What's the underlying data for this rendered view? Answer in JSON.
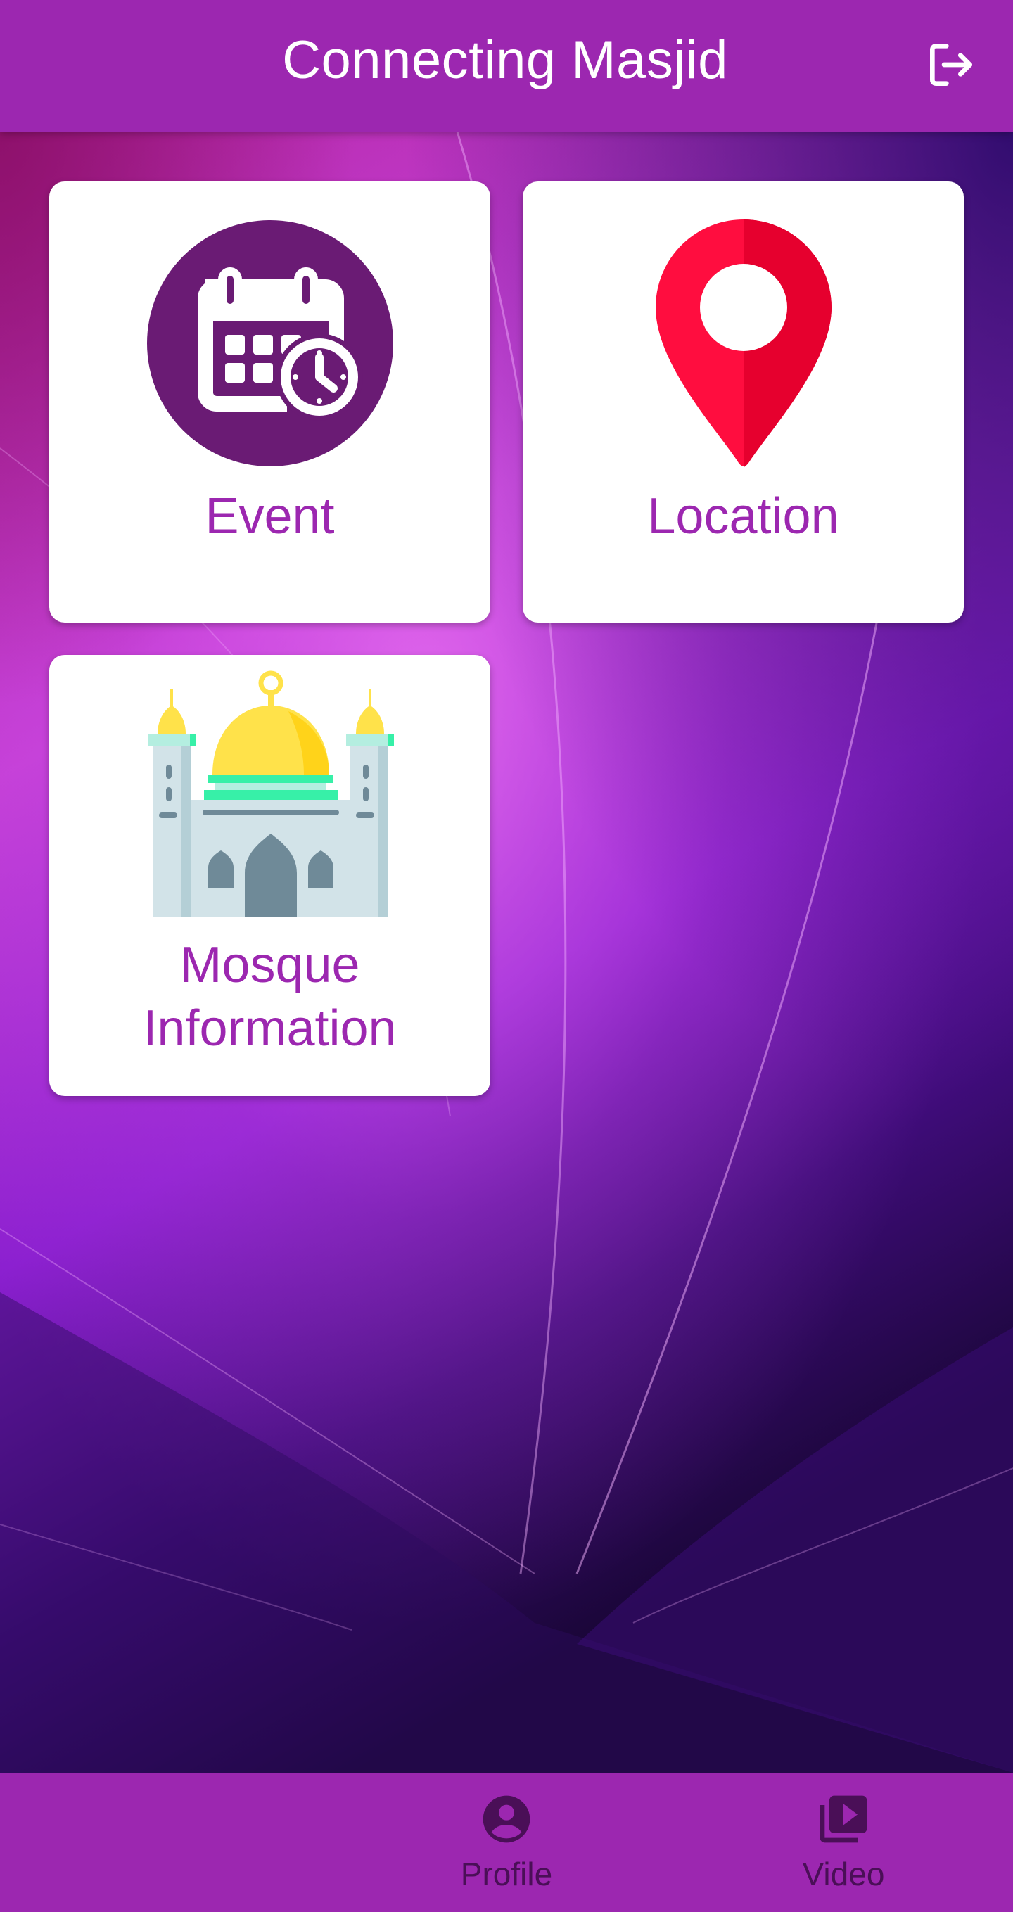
{
  "app_bar": {
    "title": "Connecting Masjid",
    "logout_icon": "logout-icon"
  },
  "menu": {
    "cards": [
      {
        "label": "Event",
        "icon": "calendar-clock-icon"
      },
      {
        "label": "Location",
        "icon": "map-pin-icon"
      },
      {
        "label": "Mosque\nInformation",
        "icon": "mosque-icon"
      }
    ]
  },
  "bottom_nav": {
    "items": [
      {
        "label": "Profile",
        "icon": "account-circle-icon"
      },
      {
        "label": "Video",
        "icon": "video-library-icon"
      }
    ]
  },
  "colors": {
    "primary": "#9c27b0",
    "label_purple": "#9c27b0",
    "event_circle": "#6a1b74",
    "pin_red": "#ff0033",
    "dome_yellow": "#ffe24a",
    "nav_label": "#4a0f57"
  }
}
